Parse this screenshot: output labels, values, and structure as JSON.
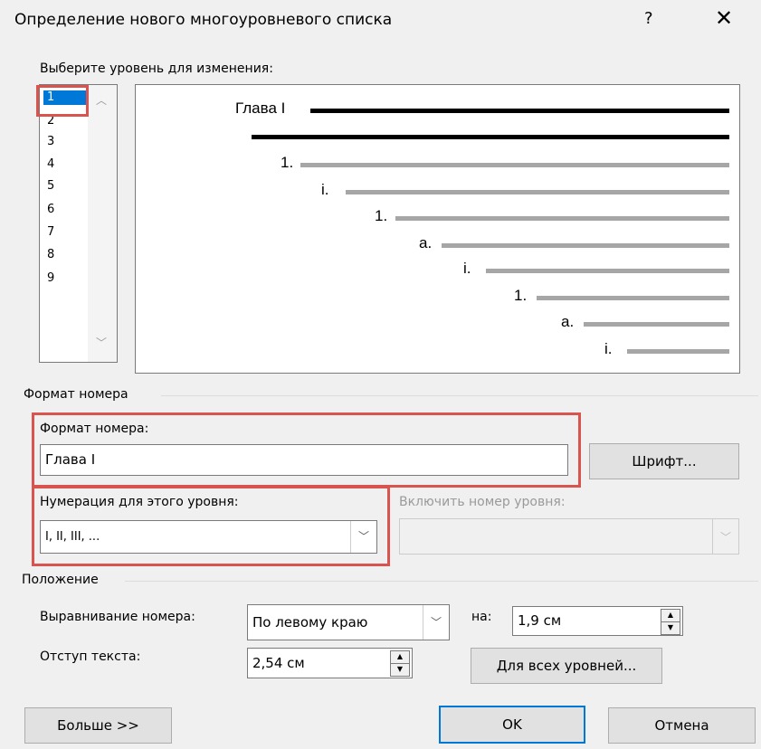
{
  "window": {
    "title": "Определение нового многоуровневого списка",
    "help_label": "?",
    "close_label": "✕"
  },
  "levels": {
    "label": "Выберите уровень для изменения:",
    "items": [
      "1",
      "2",
      "3",
      "4",
      "5",
      "6",
      "7",
      "8",
      "9"
    ],
    "selected": "1"
  },
  "preview": {
    "labels": [
      "Глава I",
      "1.",
      "i.",
      "1.",
      "a.",
      "i.",
      "1.",
      "a.",
      "i."
    ]
  },
  "format_section": {
    "title": "Формат номера",
    "number_format_label": "Формат номера:",
    "number_format_value": "Глава I",
    "font_button": "Шрифт...",
    "numbering_label": "Нумерация для этого уровня:",
    "numbering_value": "I, II, III, ...",
    "include_level_label": "Включить номер уровня:"
  },
  "position_section": {
    "title": "Положение",
    "alignment_label": "Выравнивание номера:",
    "alignment_value": "По левому краю",
    "at_label": "на:",
    "at_value": "1,9 см",
    "indent_label": "Отступ текста:",
    "indent_value": "2,54 см",
    "all_levels_button": "Для всех уровней..."
  },
  "footer": {
    "more_button": "Больше >>",
    "ok_button": "OK",
    "cancel_button": "Отмена"
  },
  "colors": {
    "accent": "#0078d7",
    "highlight": "#d9534f"
  }
}
